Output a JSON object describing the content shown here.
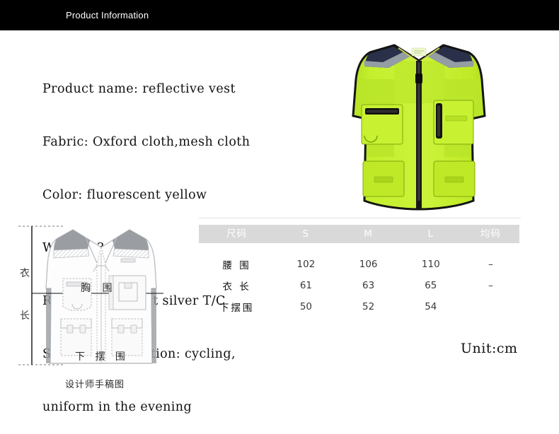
{
  "header": {
    "title": "Product Information",
    "bg": "#000000",
    "text_color": "#ffffff"
  },
  "specs": {
    "lines": [
      "Product name: reflective vest",
      "Fabric: Oxford cloth,mesh cloth",
      "Color: fluorescent yellow",
      "Weight: 360g",
      "Reflection: bright silver T/C",
      "Scope of application: cycling,",
      "uniform in the evening"
    ]
  },
  "product_photo": {
    "alt": "fluorescent yellow reflective safety vest",
    "colors": {
      "body": "#c2ee26",
      "body_shade": "#a8d71c",
      "mesh": "#bce82c",
      "shoulder": "#2a3049",
      "reflective": "#9aa2aa",
      "trim": "#121212",
      "zipper": "#1a1a1a"
    }
  },
  "size_table": {
    "headers": [
      "尺码",
      "S",
      "M",
      "L",
      "均码"
    ],
    "header_bg": "#d9d9d9",
    "header_color": "#ffffff",
    "rows": [
      {
        "label": "腰  围",
        "s": "102",
        "m": "106",
        "l": "110",
        "u": "–"
      },
      {
        "label": "衣  长",
        "s": "61",
        "m": "63",
        "l": "65",
        "u": "–"
      },
      {
        "label": "下摆围",
        "s": "50",
        "m": "52",
        "l": "54",
        "u": ""
      }
    ]
  },
  "unit_note": "Unit:cm",
  "sketch": {
    "caption": "设计师手稿图",
    "labels": {
      "length_char1": "衣",
      "length_char2": "长",
      "chest": "胸   围",
      "hem": "下  摆  围"
    },
    "colors": {
      "outline": "#b9bcc0",
      "fill": "#fdfdfd",
      "shoulder": "#9a9da1",
      "reflective": "#cfd2d6",
      "guide": "#1a1a1a"
    }
  }
}
